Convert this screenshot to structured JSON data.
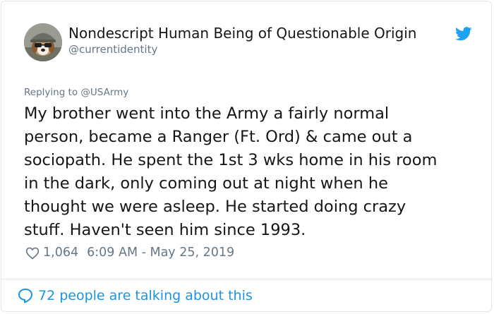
{
  "author": {
    "display_name": "Nondescript Human Being of Questionable Origin",
    "handle": "@currentidentity",
    "avatar_icon": "dog-wearing-cap-avatar",
    "verified_icon": "twitter-bird-icon"
  },
  "reply": {
    "prefix": "Replying to",
    "mention": "@USArmy"
  },
  "tweet": {
    "lines": [
      "My brother went into the Army a fairly normal",
      "person, became a Ranger (Ft. Ord) & came out a",
      "sociopath. He spent the 1st 3 wks home in his room",
      "in the dark, only coming out at night when he",
      "thought we were asleep. He started doing crazy",
      "stuff. Haven't seen him since 1993."
    ]
  },
  "meta": {
    "likes": "1,064",
    "timestamp": "6:09 AM - May 25, 2019"
  },
  "footer": {
    "conversation_label": "72 people are talking about this"
  },
  "colors": {
    "brand_blue": "#1da1f2",
    "link_blue": "#1b95e0",
    "secondary_text": "#657786",
    "primary_text": "#14171a",
    "border": "#e1e8ed"
  }
}
